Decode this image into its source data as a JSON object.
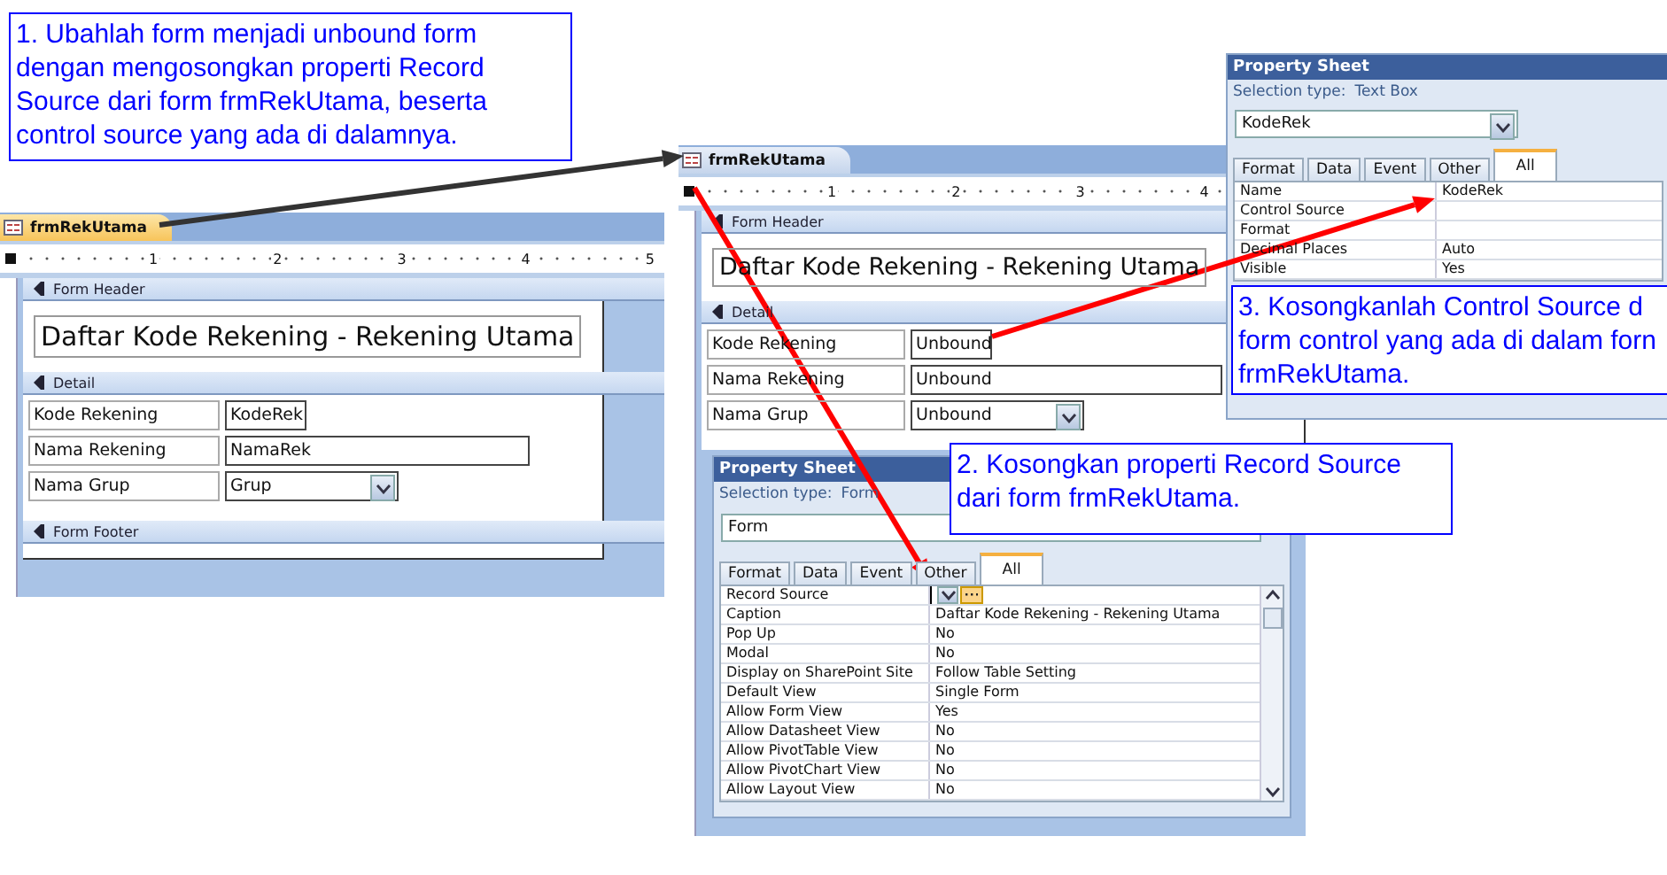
{
  "callouts": [
    {
      "text": "1. Ubahlah form menjadi unbound form dengan mengosongkan properti Record Source dari form frmRekUtama, beserta control source yang ada di dalamnya."
    },
    {
      "text": "2. Kosongkan properti Record Source dari form frmRekUtama."
    },
    {
      "text": "3. Kosongkanlah Control Source d form control yang ada di dalam forn frmRekUtama."
    }
  ],
  "forms": [
    {
      "tab": "frmRekUtama",
      "ruler": [
        "1",
        "2",
        "3",
        "4",
        "5"
      ],
      "sections": [
        {
          "label": "Form Header",
          "kind": "header"
        },
        {
          "label": "Detail",
          "kind": "detail"
        },
        {
          "label": "Form Footer",
          "kind": "footer"
        }
      ],
      "title": "Daftar Kode Rekening - Rekening Utama",
      "fields": [
        {
          "label": "Kode Rekening",
          "value": "KodeRek",
          "kind": "short"
        },
        {
          "label": "Nama Rekening",
          "value": "NamaRek",
          "kind": "long"
        },
        {
          "label": "Nama Grup",
          "value": "Grup",
          "kind": "combo"
        }
      ]
    },
    {
      "tab": "frmRekUtama",
      "ruler": [
        "1",
        "2",
        "3",
        "4"
      ],
      "sections": [
        {
          "label": "Form Header",
          "kind": "header"
        },
        {
          "label": "Detail",
          "kind": "detail"
        }
      ],
      "title": "Daftar Kode Rekening - Rekening Utama",
      "fields": [
        {
          "label": "Kode Rekening",
          "value": "Unbound",
          "kind": "short"
        },
        {
          "label": "Nama Rekening",
          "value": "Unbound",
          "kind": "long"
        },
        {
          "label": "Nama Grup",
          "value": "Unbound",
          "kind": "combo"
        }
      ]
    }
  ],
  "property_sheets": [
    {
      "title": "Property Sheet",
      "selection_label": "Selection type:",
      "selection_type": "Text Box",
      "object": "KodeRek",
      "tabs": [
        {
          "label": "Format",
          "selected": false
        },
        {
          "label": "Data",
          "selected": false
        },
        {
          "label": "Event",
          "selected": false
        },
        {
          "label": "Other",
          "selected": false
        },
        {
          "label": "All",
          "selected": true
        }
      ],
      "rows": [
        {
          "name": "Name",
          "value": "KodeRek",
          "kind": "text"
        },
        {
          "name": "Control Source",
          "value": "",
          "kind": "text"
        },
        {
          "name": "Format",
          "value": "",
          "kind": "text"
        },
        {
          "name": "Decimal Places",
          "value": "Auto",
          "kind": "text"
        },
        {
          "name": "Visible",
          "value": "Yes",
          "kind": "text"
        }
      ]
    },
    {
      "title": "Property Sheet",
      "selection_label": "Selection type:",
      "selection_type": "Form",
      "object": "Form",
      "tabs": [
        {
          "label": "Format",
          "selected": false
        },
        {
          "label": "Data",
          "selected": false
        },
        {
          "label": "Event",
          "selected": false
        },
        {
          "label": "Other",
          "selected": false
        },
        {
          "label": "All",
          "selected": true
        }
      ],
      "rows": [
        {
          "name": "Record Source",
          "value": "",
          "kind": "builder"
        },
        {
          "name": "Caption",
          "value": "Daftar Kode Rekening - Rekening Utama",
          "kind": "text"
        },
        {
          "name": "Pop Up",
          "value": "No",
          "kind": "text"
        },
        {
          "name": "Modal",
          "value": "No",
          "kind": "text"
        },
        {
          "name": "Display on SharePoint Site",
          "value": "Follow Table Setting",
          "kind": "text"
        },
        {
          "name": "Default View",
          "value": "Single Form",
          "kind": "text"
        },
        {
          "name": "Allow Form View",
          "value": "Yes",
          "kind": "text"
        },
        {
          "name": "Allow Datasheet View",
          "value": "No",
          "kind": "text"
        },
        {
          "name": "Allow PivotTable View",
          "value": "No",
          "kind": "text"
        },
        {
          "name": "Allow PivotChart View",
          "value": "No",
          "kind": "text"
        },
        {
          "name": "Allow Layout View",
          "value": "No",
          "kind": "text"
        }
      ]
    }
  ]
}
